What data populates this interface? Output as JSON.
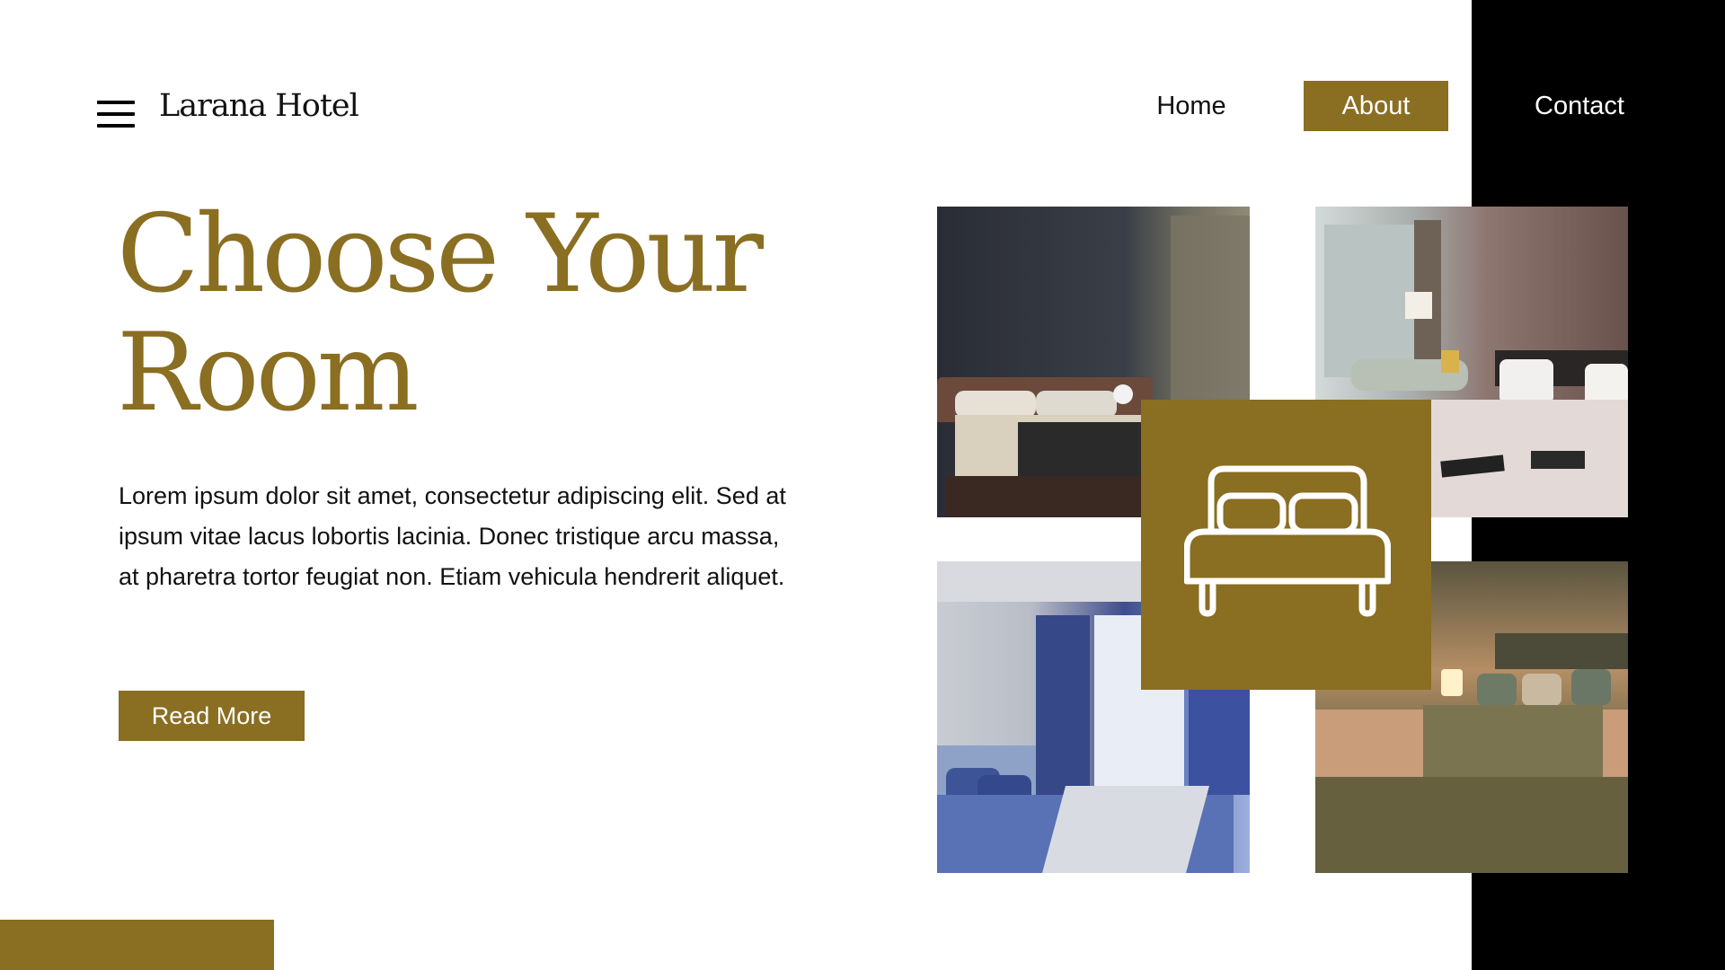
{
  "header": {
    "brand": "Larana Hotel",
    "menu_icon": "hamburger-menu-icon",
    "nav": [
      {
        "label": "Home",
        "active": false
      },
      {
        "label": "About",
        "active": true
      },
      {
        "label": "Contact",
        "active": false
      }
    ]
  },
  "hero": {
    "title_line1": "Choose Your",
    "title_line2": "Room",
    "body": "Lorem ipsum dolor sit amet, consectetur adipiscing elit. Sed at ipsum vitae lacus lobortis lacinia. Donec tristique arcu massa, at pharetra tortor feugiat non. Etiam vehicula hendrerit aliquet.",
    "cta": "Read More"
  },
  "gallery": {
    "photos": [
      "dark-wood-bedroom-photo",
      "city-view-bedroom-photo",
      "blue-curtain-bedroom-photo",
      "warm-olive-bedroom-photo"
    ],
    "center_icon": "bed-icon"
  },
  "colors": {
    "accent": "#8a6e22",
    "panel": "#000000",
    "background": "#ffffff"
  }
}
